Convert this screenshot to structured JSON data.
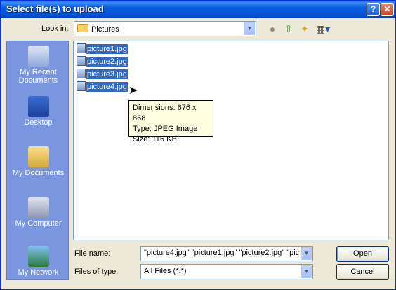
{
  "window": {
    "title": "Select file(s) to upload"
  },
  "title_buttons": {
    "help": "?",
    "close": "✕"
  },
  "lookin": {
    "label": "Look in:",
    "value": "Pictures"
  },
  "nav_icons": [
    "back-icon",
    "up-folder-icon",
    "new-folder-icon",
    "views-menu-icon"
  ],
  "places": [
    {
      "label": "My Recent Documents",
      "icon": "recent-documents-icon"
    },
    {
      "label": "Desktop",
      "icon": "desktop-icon"
    },
    {
      "label": "My Documents",
      "icon": "my-documents-icon"
    },
    {
      "label": "My Computer",
      "icon": "my-computer-icon"
    },
    {
      "label": "My Network",
      "icon": "my-network-icon"
    }
  ],
  "files": [
    {
      "name": "picture1.jpg"
    },
    {
      "name": "picture2.jpg"
    },
    {
      "name": "picture3.jpg"
    },
    {
      "name": "picture4.jpg"
    }
  ],
  "tooltip": {
    "dimensions": "Dimensions: 676 x 868",
    "type": "Type: JPEG Image",
    "size": "Size: 116 KB"
  },
  "file_name": {
    "label": "File name:",
    "value": "\"picture4.jpg\" \"picture1.jpg\" \"picture2.jpg\" \"pic"
  },
  "file_type": {
    "label": "Files of type:",
    "value": "All Files (*.*)"
  },
  "buttons": {
    "open": "Open",
    "cancel": "Cancel"
  }
}
